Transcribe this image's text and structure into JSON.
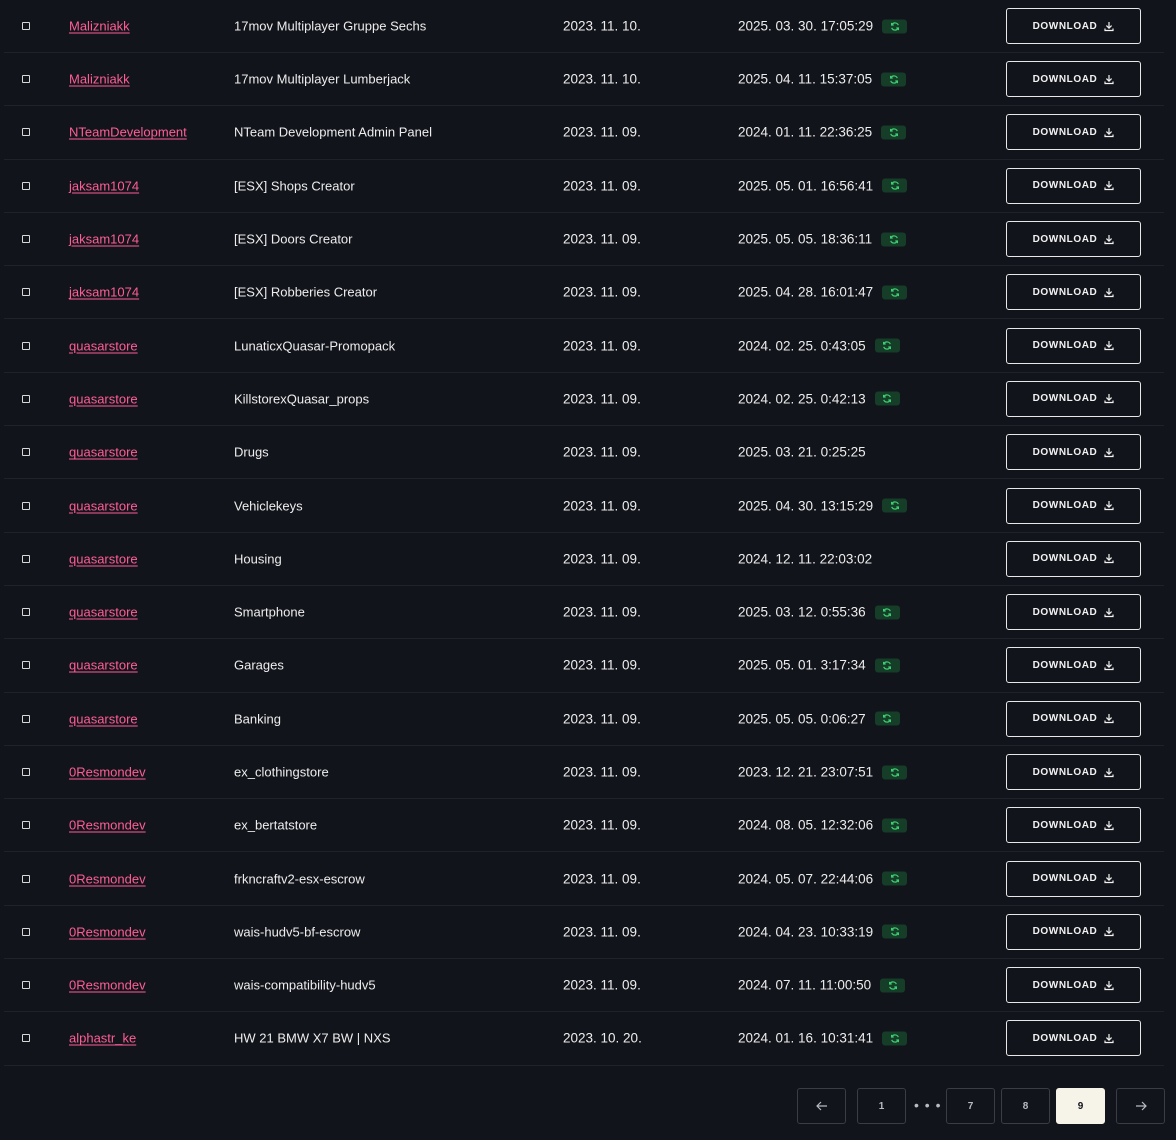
{
  "table": {
    "download_label": "DOWNLOAD",
    "rows": [
      {
        "author": "Malizniakk",
        "name": "17mov Multiplayer Gruppe Sechs",
        "created": "2023. 11. 10.",
        "updated": "2025. 03. 30. 17:05:29",
        "synced": true
      },
      {
        "author": "Malizniakk",
        "name": "17mov Multiplayer Lumberjack",
        "created": "2023. 11. 10.",
        "updated": "2025. 04. 11. 15:37:05",
        "synced": true
      },
      {
        "author": "NTeamDevelopment",
        "name": "NTeam Development Admin Panel",
        "created": "2023. 11. 09.",
        "updated": "2024. 01. 11. 22:36:25",
        "synced": true
      },
      {
        "author": "jaksam1074",
        "name": "[ESX] Shops Creator",
        "created": "2023. 11. 09.",
        "updated": "2025. 05. 01. 16:56:41",
        "synced": true
      },
      {
        "author": "jaksam1074",
        "name": "[ESX] Doors Creator",
        "created": "2023. 11. 09.",
        "updated": "2025. 05. 05. 18:36:11",
        "synced": true
      },
      {
        "author": "jaksam1074",
        "name": "[ESX] Robberies Creator",
        "created": "2023. 11. 09.",
        "updated": "2025. 04. 28. 16:01:47",
        "synced": true
      },
      {
        "author": "quasarstore",
        "name": "LunaticxQuasar-Promopack",
        "created": "2023. 11. 09.",
        "updated": "2024. 02. 25. 0:43:05",
        "synced": true
      },
      {
        "author": "quasarstore",
        "name": "KillstorexQuasar_props",
        "created": "2023. 11. 09.",
        "updated": "2024. 02. 25. 0:42:13",
        "synced": true
      },
      {
        "author": "quasarstore",
        "name": "Drugs",
        "created": "2023. 11. 09.",
        "updated": "2025. 03. 21. 0:25:25",
        "synced": false
      },
      {
        "author": "quasarstore",
        "name": "Vehiclekeys",
        "created": "2023. 11. 09.",
        "updated": "2025. 04. 30. 13:15:29",
        "synced": true
      },
      {
        "author": "quasarstore",
        "name": "Housing",
        "created": "2023. 11. 09.",
        "updated": "2024. 12. 11. 22:03:02",
        "synced": false
      },
      {
        "author": "quasarstore",
        "name": "Smartphone",
        "created": "2023. 11. 09.",
        "updated": "2025. 03. 12. 0:55:36",
        "synced": true
      },
      {
        "author": "quasarstore",
        "name": "Garages",
        "created": "2023. 11. 09.",
        "updated": "2025. 05. 01. 3:17:34",
        "synced": true
      },
      {
        "author": "quasarstore",
        "name": "Banking",
        "created": "2023. 11. 09.",
        "updated": "2025. 05. 05. 0:06:27",
        "synced": true
      },
      {
        "author": "0Resmondev",
        "name": "ex_clothingstore",
        "created": "2023. 11. 09.",
        "updated": "2023. 12. 21. 23:07:51",
        "synced": true
      },
      {
        "author": "0Resmondev",
        "name": "ex_bertatstore",
        "created": "2023. 11. 09.",
        "updated": "2024. 08. 05. 12:32:06",
        "synced": true
      },
      {
        "author": "0Resmondev",
        "name": "frkncraftv2-esx-escrow",
        "created": "2023. 11. 09.",
        "updated": "2024. 05. 07. 22:44:06",
        "synced": true
      },
      {
        "author": "0Resmondev",
        "name": "wais-hudv5-bf-escrow",
        "created": "2023. 11. 09.",
        "updated": "2024. 04. 23. 10:33:19",
        "synced": true
      },
      {
        "author": "0Resmondev",
        "name": "wais-compatibility-hudv5",
        "created": "2023. 11. 09.",
        "updated": "2024. 07. 11. 11:00:50",
        "synced": true
      },
      {
        "author": "alphastr_ke",
        "name": "HW 21 BMW X7 BW | NXS",
        "created": "2023. 10. 20.",
        "updated": "2024. 01. 16. 10:31:41",
        "synced": true
      }
    ]
  },
  "pagination": {
    "prev_icon": "arrow-left-icon",
    "next_icon": "arrow-right-icon",
    "first": "1",
    "ellipsis": "• • •",
    "pages": [
      "7",
      "8",
      "9"
    ],
    "current": "9"
  },
  "colors": {
    "background": "#12141b",
    "author_link": "#ff5d96",
    "sync_badge_bg": "#163d28",
    "sync_icon": "#3fcf73",
    "active_page_bg": "#f6f3e8"
  }
}
